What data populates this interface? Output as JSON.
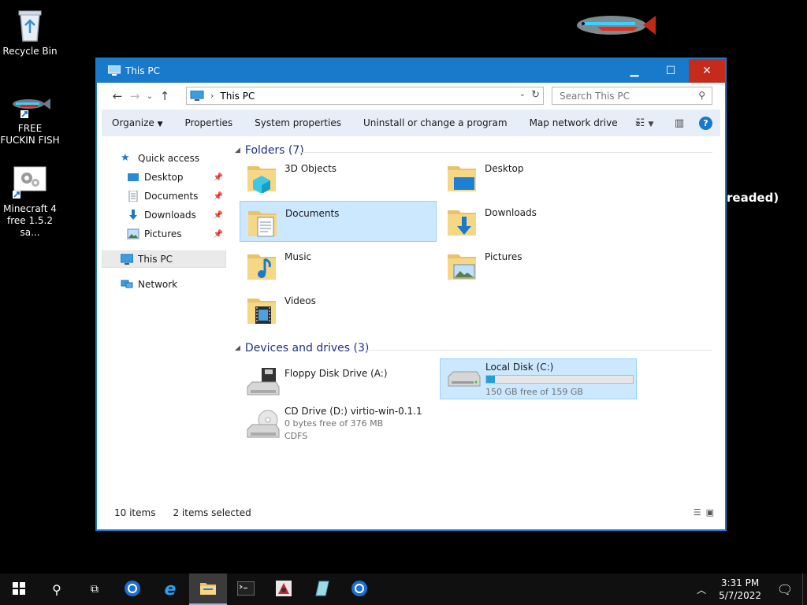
{
  "desktop": {
    "icons": [
      {
        "label": "Recycle Bin"
      },
      {
        "label": "FREE FUCKIN FISH"
      },
      {
        "label": "Minecraft 4 free 1.5.2 sa..."
      }
    ],
    "background_text": "readed)"
  },
  "window": {
    "title": "This PC",
    "address": "This PC",
    "search_placeholder": "Search This PC",
    "toolbar": {
      "organize": "Organize",
      "properties": "Properties",
      "system_properties": "System properties",
      "uninstall": "Uninstall or change a program",
      "map_drive": "Map network drive",
      "more": "»"
    },
    "sidebar": {
      "quick_access": "Quick access",
      "desktop": "Desktop",
      "documents": "Documents",
      "downloads": "Downloads",
      "pictures": "Pictures",
      "this_pc": "This PC",
      "network": "Network"
    },
    "folders_header": "Folders (7)",
    "folders": [
      {
        "label": "3D Objects"
      },
      {
        "label": "Desktop"
      },
      {
        "label": "Documents"
      },
      {
        "label": "Downloads"
      },
      {
        "label": "Music"
      },
      {
        "label": "Pictures"
      },
      {
        "label": "Videos"
      }
    ],
    "drives_header": "Devices and drives (3)",
    "drives": {
      "floppy": {
        "label": "Floppy Disk Drive (A:)"
      },
      "local": {
        "label": "Local Disk (C:)",
        "free": "150 GB free of 159 GB",
        "used_fraction": 0.057
      },
      "cd": {
        "label": "CD Drive (D:) virtio-win-0.1.1",
        "free": "0 bytes free of 376 MB",
        "fs": "CDFS"
      }
    },
    "status": {
      "items": "10 items",
      "selected": "2 items selected"
    }
  },
  "taskbar": {
    "time": "3:31 PM",
    "date": "5/7/2022"
  },
  "colors": {
    "accent": "#1979ca",
    "selection": "#cce8ff",
    "close": "#c42b1c"
  }
}
